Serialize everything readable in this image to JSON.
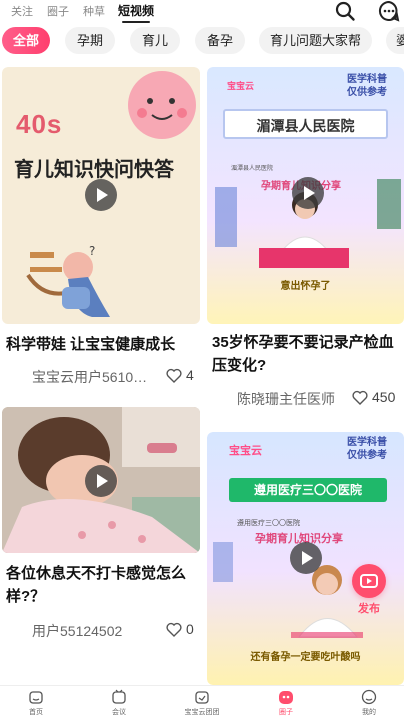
{
  "top_tabs": [
    "关注",
    "圈子",
    "种草",
    "短视频"
  ],
  "categories": [
    "全部",
    "孕期",
    "育儿",
    "备孕",
    "育儿问题大家帮",
    "婆"
  ],
  "cards": [
    {
      "title": "科学带娃 让宝宝健康成长",
      "author": "宝宝云用户5610…",
      "likes": "4",
      "cover": {
        "big_text": "40s",
        "headline": "育儿知识快问快答"
      }
    },
    {
      "title": "35岁怀孕要不要记录产检血压变化?",
      "author": "陈晓珊主任医师",
      "likes": "450",
      "cover": {
        "brand": "宝宝云",
        "tag_line1": "医学科普",
        "tag_line2": "仅供参考",
        "banner": "湄潭县人民医院",
        "hosp_small": "湄潭县人民医院",
        "share": "孕期育儿知识分享",
        "caption": "意出怀孕了"
      }
    },
    {
      "title": "各位休息天不打卡感觉怎么样?？",
      "author": "用户55124502",
      "likes": "0",
      "cover": {}
    },
    {
      "title": "",
      "author": "",
      "likes": "",
      "cover": {
        "brand": "宝宝云",
        "tag_line1": "医学科普",
        "tag_line2": "仅供参考",
        "banner": "遵用医疗三〇〇医院",
        "hosp_small": "遵用医疗三〇〇医院",
        "share": "孕期育儿知识分享",
        "caption": "还有备孕一定要吃叶酸吗"
      }
    }
  ],
  "publish_label": "发布",
  "bottom_nav": [
    "首页",
    "会议",
    "宝宝云团团",
    "圈子",
    "我的"
  ],
  "colors": {
    "accent": "#ff4d6d",
    "pill_active": "#ff3f6e"
  },
  "icons": [
    "search-icon",
    "message-icon",
    "play-icon",
    "heart-icon",
    "publish-icon",
    "home-icon",
    "meeting-icon",
    "group-icon",
    "circle-icon",
    "profile-icon"
  ]
}
